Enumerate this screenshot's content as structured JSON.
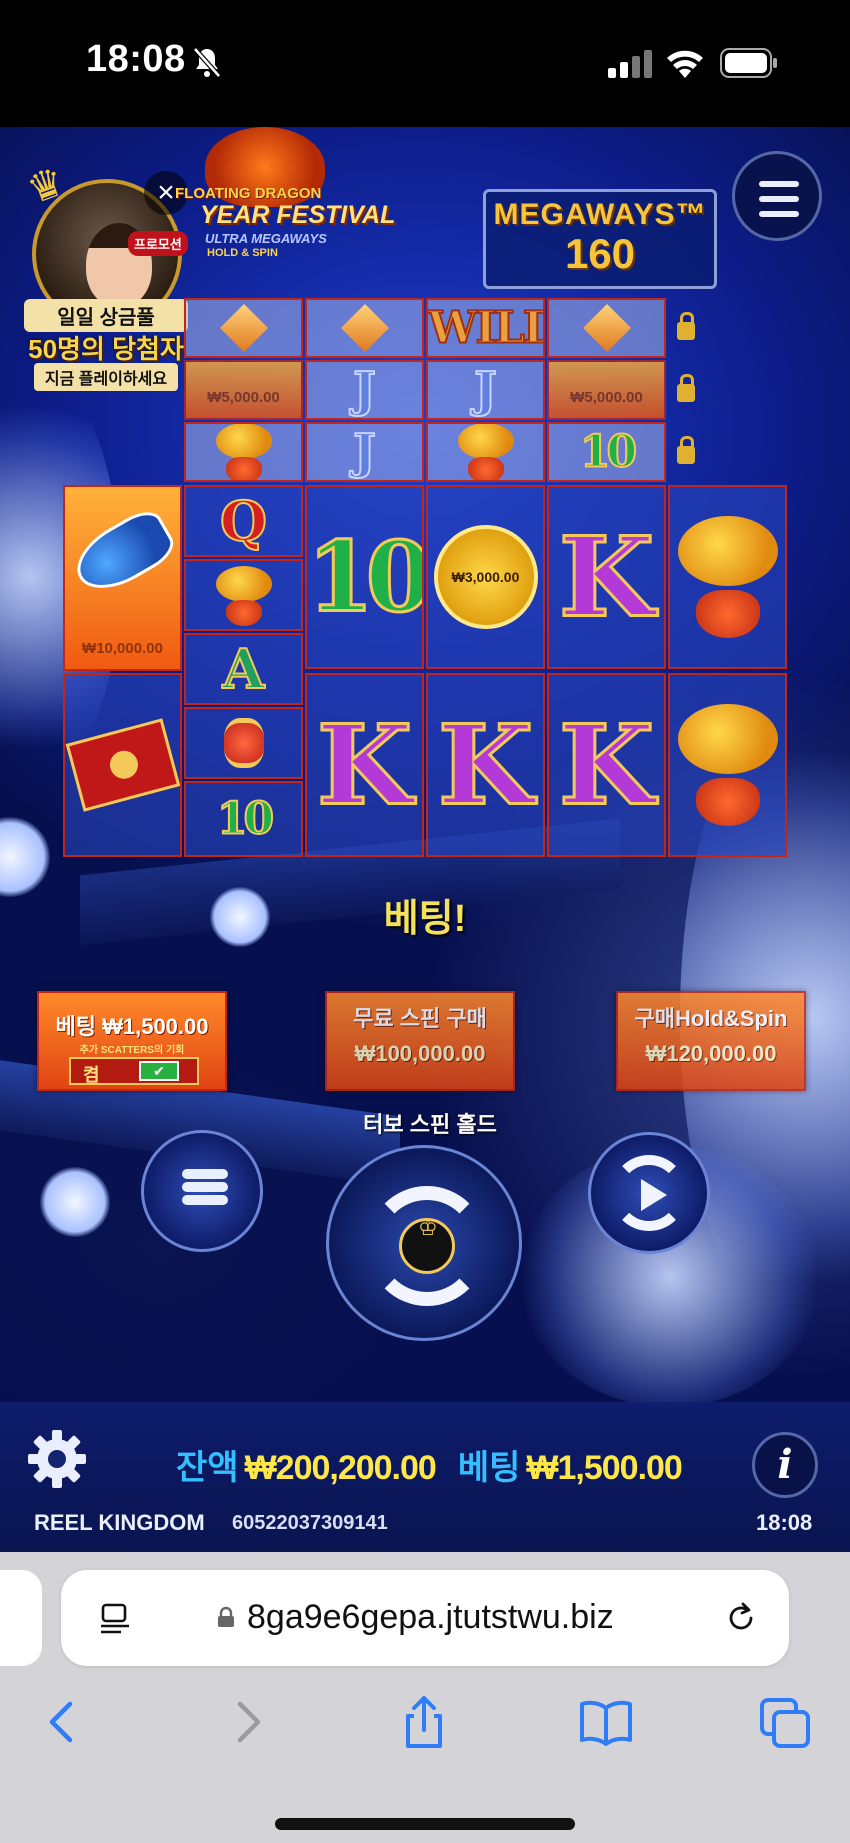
{
  "status_bar": {
    "time": "18:08"
  },
  "promo": {
    "tag": "프로모션",
    "line1": "일일 상금풀",
    "line2": "50명의 당첨자",
    "line3": "지금 플레이하세요",
    "close": "×"
  },
  "logo": {
    "line1": "FLOATING DRAGON",
    "line2": "YEAR FESTIVAL",
    "line3": "ULTRA MEGAWAYS",
    "line4": "HOLD & SPIN"
  },
  "megaways": {
    "label": "MEGAWAYS™",
    "value": "160"
  },
  "reels": {
    "wild": "WILD",
    "top_value": "₩5,000.00",
    "coin_value": "₩3,000.00",
    "fish_value": "₩10,000.00",
    "sym_k": "K",
    "sym_10": "10",
    "sym_q": "Q",
    "sym_a": "A",
    "sym_j": "J"
  },
  "message": "베팅!",
  "ante": {
    "title": "베팅 ₩1,500.00",
    "note": "추가 SCATTERS의 기회",
    "toggle_label": "켬",
    "check": "✔"
  },
  "buy_free_spins": {
    "title": "무료 스핀 구매",
    "price": "₩100,000.00"
  },
  "buy_hold_spin": {
    "title": "구매Hold&Spin",
    "price": "₩120,000.00"
  },
  "turbo_label": "터보 스핀 홀드",
  "bottom_bar": {
    "balance_label": "잔액",
    "balance_value": "₩200,200.00",
    "bet_label": "베팅",
    "bet_value": "₩1,500.00",
    "provider": "REEL KINGDOM",
    "round_id": "60522037309141",
    "time": "18:08",
    "info": "i"
  },
  "browser": {
    "url": "8ga9e6gepa.jtutstwu.biz"
  },
  "colors": {
    "accent_yellow": "#ffe74a",
    "label_blue": "#34c0ff",
    "reel_border": "#c0261a",
    "ios_blue": "#2f7df6"
  }
}
